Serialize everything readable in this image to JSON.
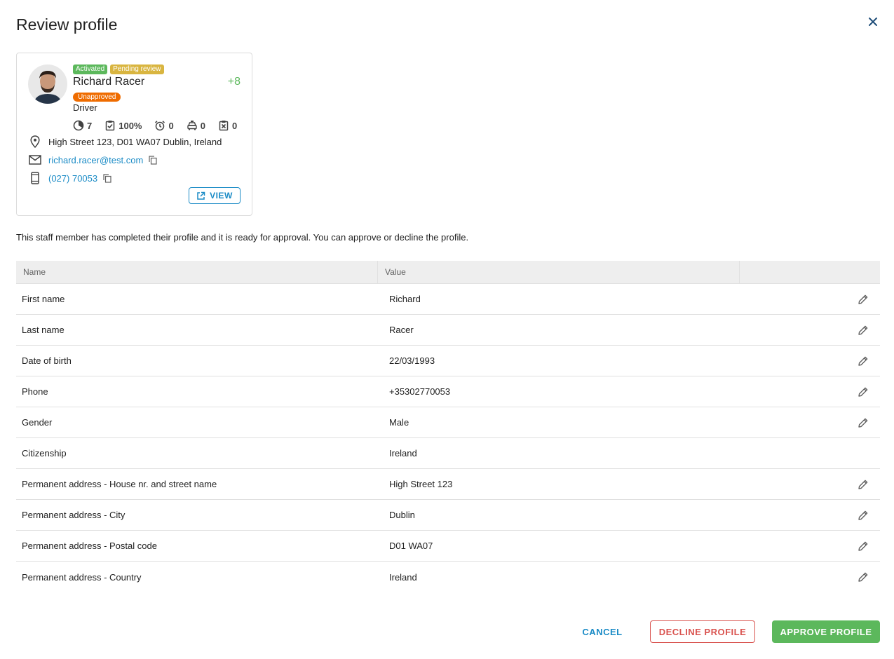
{
  "dialog": {
    "title": "Review profile",
    "close_icon": "close-icon"
  },
  "profile": {
    "name": "Richard Racer",
    "role": "Driver",
    "score": "+8",
    "badges": [
      "Activated",
      "Pending review"
    ],
    "status_badge": "Unapproved",
    "stats": [
      {
        "icon": "pie-chart-icon",
        "value": "7"
      },
      {
        "icon": "checklist-icon",
        "value": "100%"
      },
      {
        "icon": "alarm-clock-icon",
        "value": "0"
      },
      {
        "icon": "taxi-icon",
        "value": "0"
      },
      {
        "icon": "cancel-box-icon",
        "value": "0"
      }
    ],
    "address": "High Street 123, D01 WA07 Dublin, Ireland",
    "email": "richard.racer@test.com",
    "phone": "(027) 70053",
    "view_label": "VIEW"
  },
  "description": "This staff member has completed their profile and it is ready for approval. You can approve or decline the profile.",
  "table": {
    "headers": {
      "name": "Name",
      "value": "Value"
    },
    "rows": [
      {
        "name": "First name",
        "value": "Richard",
        "editable": true
      },
      {
        "name": "Last name",
        "value": "Racer",
        "editable": true
      },
      {
        "name": "Date of birth",
        "value": "22/03/1993",
        "editable": true
      },
      {
        "name": "Phone",
        "value": "+35302770053",
        "editable": true
      },
      {
        "name": "Gender",
        "value": "Male",
        "editable": true
      },
      {
        "name": "Citizenship",
        "value": "Ireland",
        "editable": false
      },
      {
        "name": "Permanent address - House nr. and street name",
        "value": "High Street 123",
        "editable": true
      },
      {
        "name": "Permanent address - City",
        "value": "Dublin",
        "editable": true
      },
      {
        "name": "Permanent address - Postal code",
        "value": "D01 WA07",
        "editable": true
      },
      {
        "name": "Permanent address - Country",
        "value": "Ireland",
        "editable": true
      }
    ]
  },
  "footer": {
    "cancel_label": "CANCEL",
    "decline_label": "DECLINE PROFILE",
    "approve_label": "APPROVE PROFILE"
  },
  "colors": {
    "accent_blue": "#1a8bc6",
    "approve_green": "#5cb85c",
    "decline_red": "#d9534f",
    "pending_yellow": "#d9b540",
    "unapproved_orange": "#ef6c00"
  }
}
